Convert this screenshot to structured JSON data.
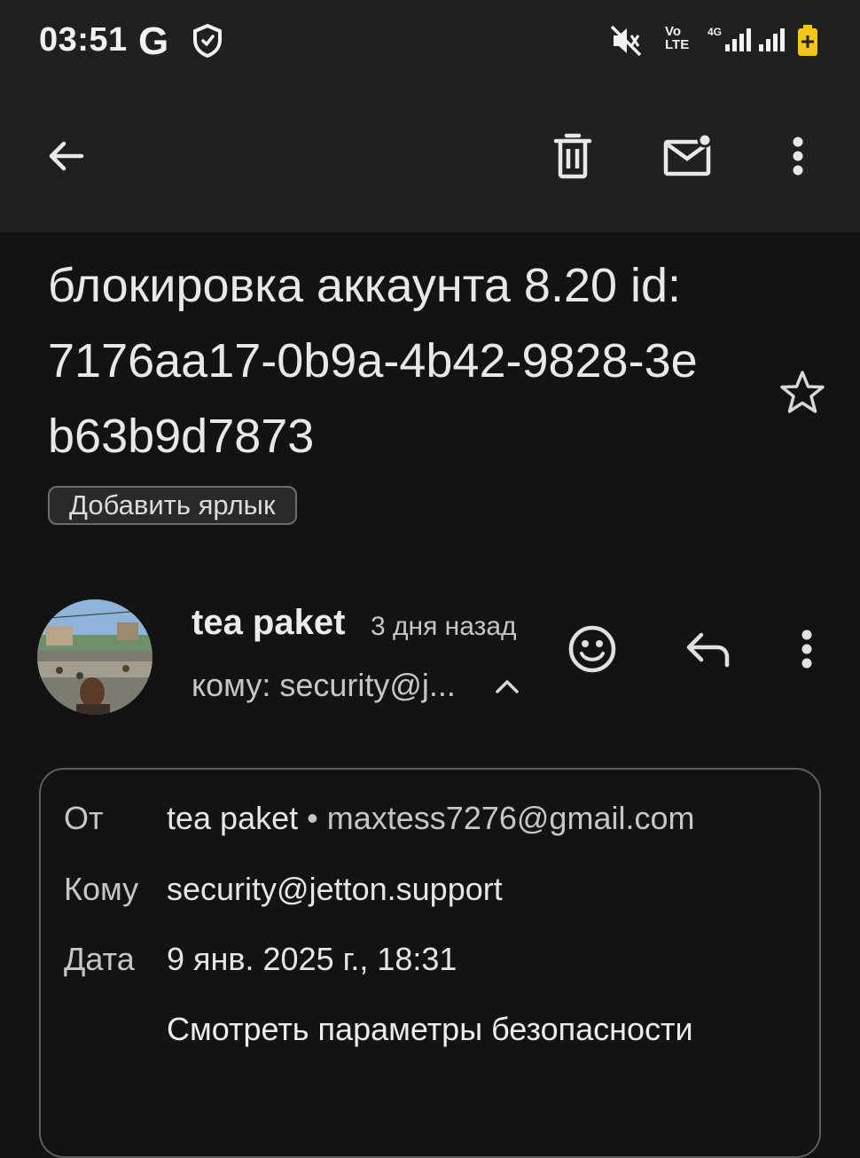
{
  "status_bar": {
    "time": "03:51",
    "google_icon": "G",
    "volte_top": "Vo",
    "volte_bottom": "LTE",
    "network_type": "4G"
  },
  "toolbar": {
    "back_icon": "arrow-back-icon",
    "delete_icon": "trash-icon",
    "mark_unread_icon": "mail-unread-icon",
    "more_icon": "more-vert-icon"
  },
  "email": {
    "subject": "блокировка аккаунта 8.20 id:7176aa17-0b9a-4b42-9828-3eb63b9d7873",
    "add_label_button": "Добавить ярлык",
    "sender_name": "tea paket",
    "sent_ago": "3 дня назад",
    "recipient_summary": "кому: security@j...",
    "details": {
      "from_label": "От",
      "from_name": "tea paket",
      "separator": "•",
      "from_email": "maxtess7276@gmail.com",
      "to_label": "Кому",
      "to_email": "security@jetton.support",
      "date_label": "Дата",
      "date_value": "9 янв. 2025 г., 18:31",
      "security_link": "Смотреть параметры безопасности"
    }
  },
  "colors": {
    "background": "#131313",
    "bar": "#202020",
    "text_primary": "#e3e3e3",
    "text_secondary": "#c6c6c6",
    "battery": "#f5c518"
  }
}
